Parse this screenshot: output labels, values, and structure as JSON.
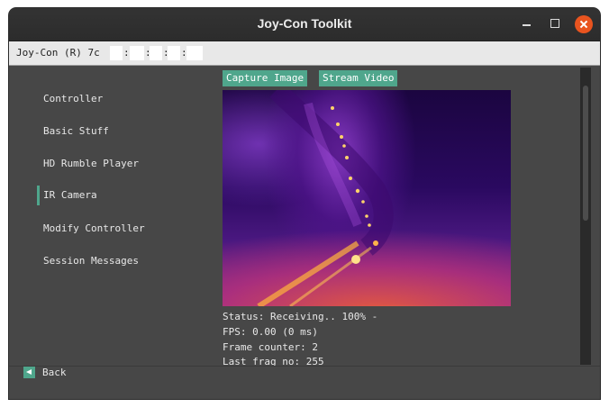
{
  "window": {
    "title": "Joy-Con Toolkit"
  },
  "device": {
    "label": "Joy-Con (R) 7c"
  },
  "sidebar": {
    "items": [
      {
        "label": "Controller"
      },
      {
        "label": "Basic Stuff"
      },
      {
        "label": "HD Rumble Player"
      },
      {
        "label": "IR Camera",
        "active": true
      },
      {
        "label": "Modify Controller"
      },
      {
        "label": "Session Messages"
      }
    ]
  },
  "ir": {
    "capture_label": "Capture Image",
    "stream_label": "Stream Video",
    "status_lines": [
      "Status: Receiving.. 100% -",
      "FPS: 0.00 (0 ms)",
      "Frame counter: 2",
      "Last frag no: 255"
    ]
  },
  "footer": {
    "back_label": "Back"
  },
  "colors": {
    "accent": "#4fa68c",
    "window_bg": "#474747",
    "close": "#e9541f"
  }
}
